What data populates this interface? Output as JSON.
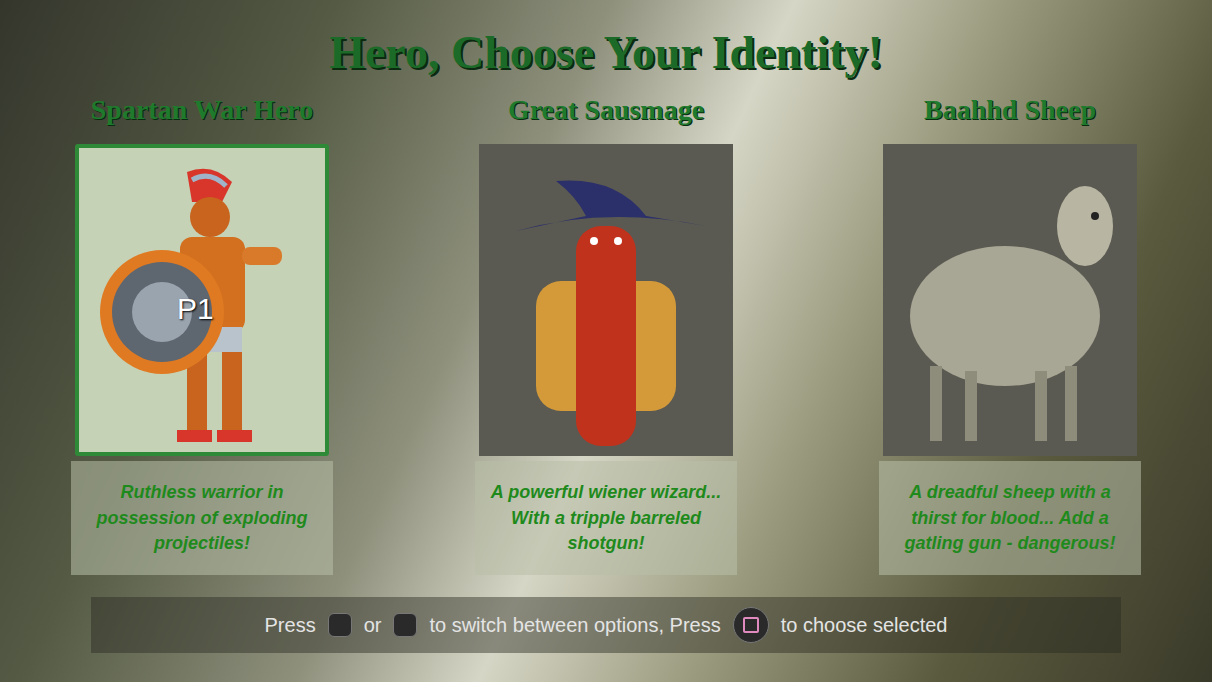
{
  "title": "Hero, Choose Your Identity!",
  "heroes": [
    {
      "name": "Spartan War Hero",
      "description": "Ruthless warrior in possession of exploding projectiles!",
      "selected": true
    },
    {
      "name": "Great Sausmage",
      "description": "A powerful wiener wizard... With a tripple barreled shotgun!",
      "selected": false
    },
    {
      "name": "Baahhd Sheep",
      "description": "A dreadful sheep with a thirst for blood... Add a gatling gun - dangerous!",
      "selected": false
    }
  ],
  "cursor": {
    "label": "P1"
  },
  "footer": {
    "texts": [
      "Press",
      "or",
      "to switch between options, Press",
      "to choose selected"
    ]
  }
}
